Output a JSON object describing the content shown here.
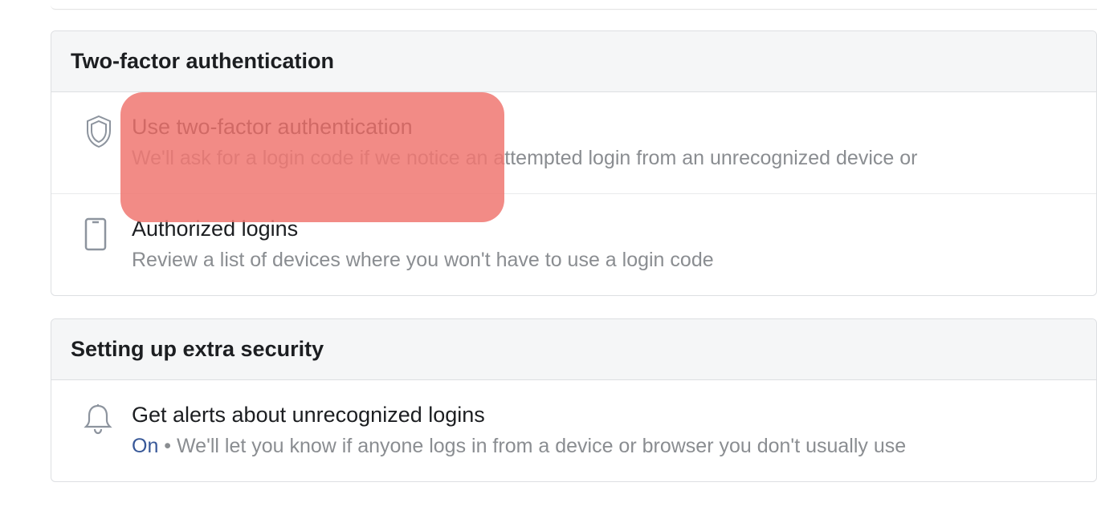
{
  "twofactor": {
    "header": "Two-factor authentication",
    "items": [
      {
        "title": "Use two-factor authentication",
        "desc": "We'll ask for a login code if we notice an attempted login from an unrecognized device or"
      },
      {
        "title": "Authorized logins",
        "desc": "Review a list of devices where you won't have to use a login code"
      }
    ]
  },
  "extra_security": {
    "header": "Setting up extra security",
    "items": [
      {
        "title": "Get alerts about unrecognized logins",
        "status": "On",
        "sep": " • ",
        "desc": "We'll let you know if anyone logs in from a device or browser you don't usually use"
      }
    ]
  }
}
